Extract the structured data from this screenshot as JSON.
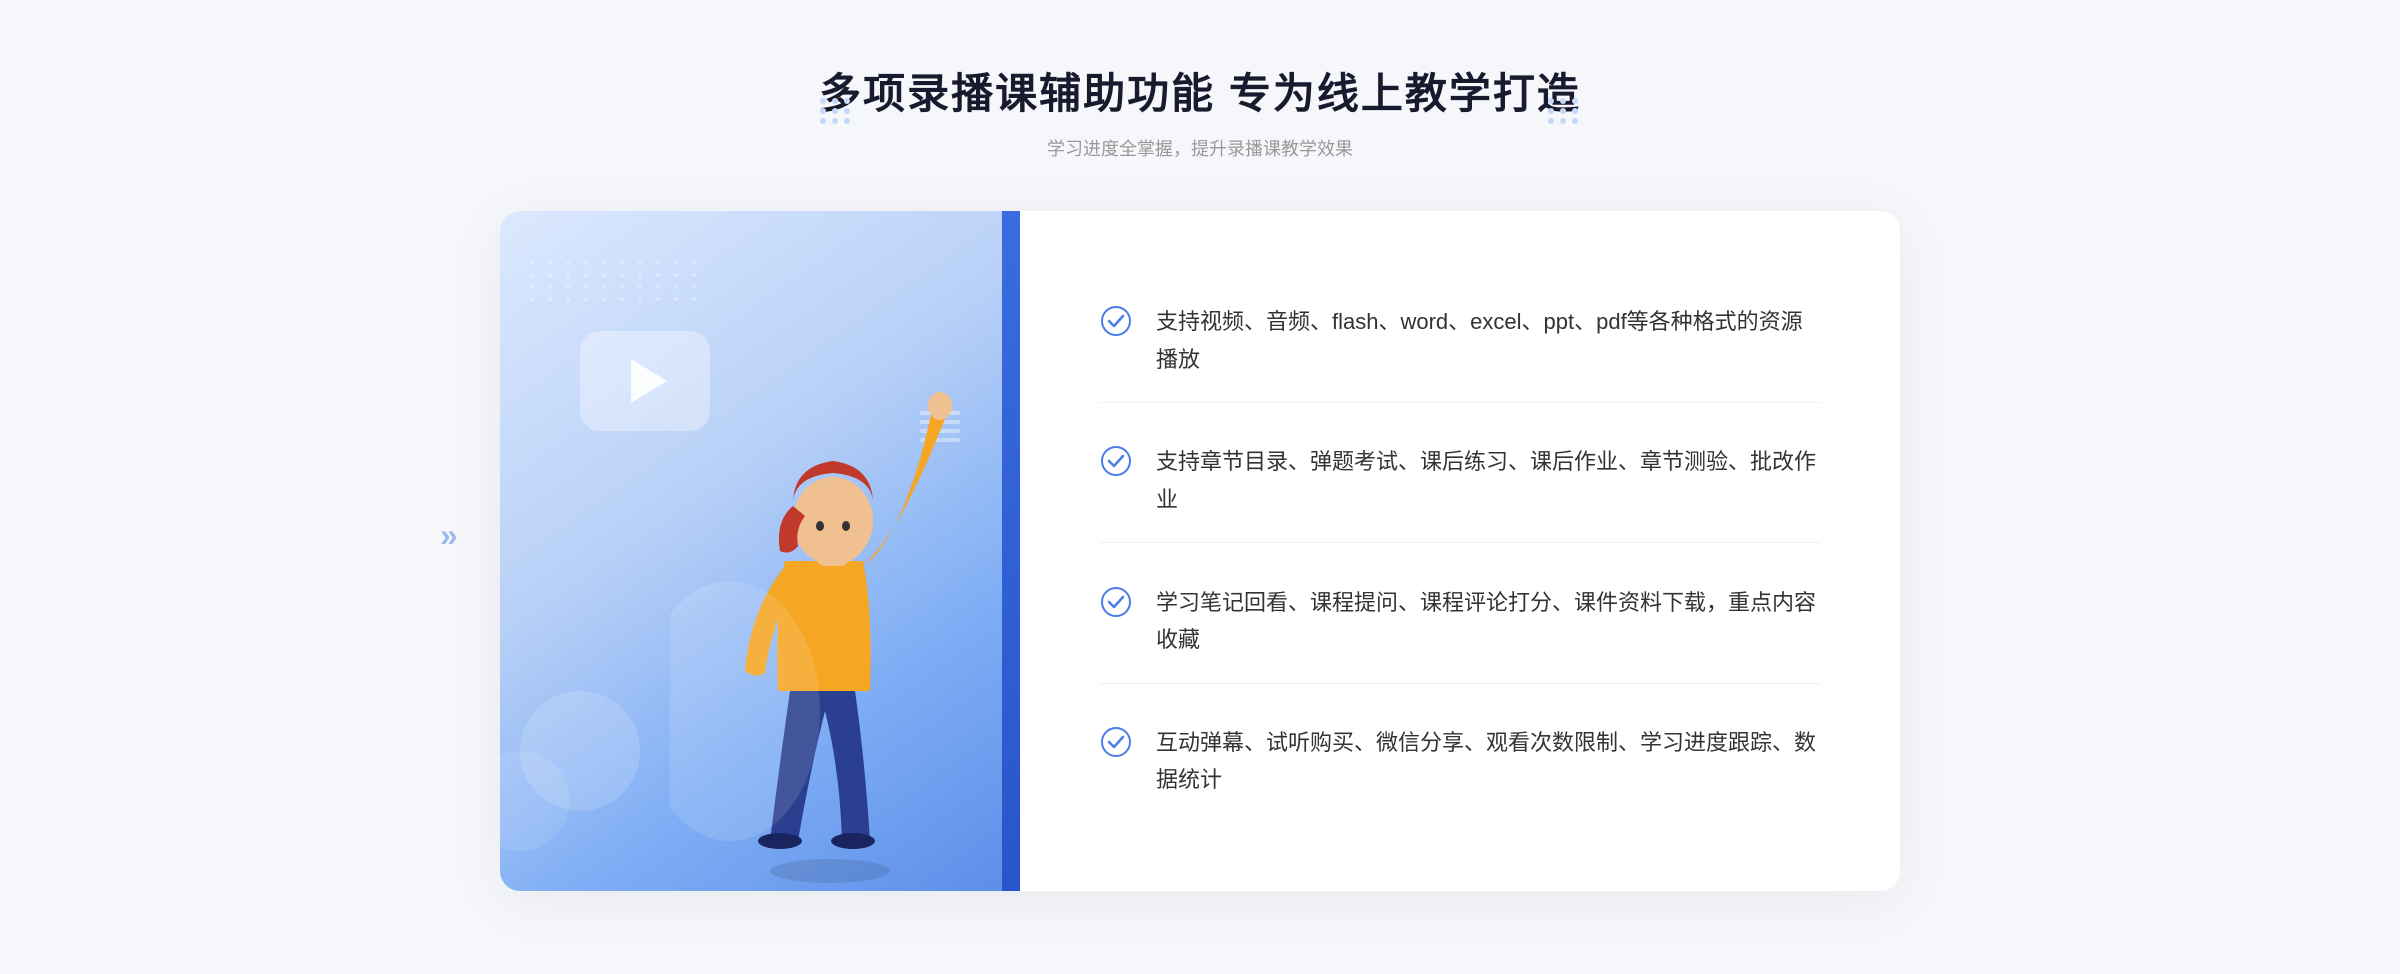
{
  "header": {
    "title": "多项录播课辅助功能 专为线上教学打造",
    "subtitle": "学习进度全掌握，提升录播课教学效果"
  },
  "features": [
    {
      "id": 1,
      "text": "支持视频、音频、flash、word、excel、ppt、pdf等各种格式的资源播放"
    },
    {
      "id": 2,
      "text": "支持章节目录、弹题考试、课后练习、课后作业、章节测验、批改作业"
    },
    {
      "id": 3,
      "text": "学习笔记回看、课程提问、课程评论打分、课件资料下载，重点内容收藏"
    },
    {
      "id": 4,
      "text": "互动弹幕、试听购买、微信分享、观看次数限制、学习进度跟踪、数据统计"
    }
  ],
  "icons": {
    "check": "check-circle-icon",
    "play": "play-icon"
  },
  "colors": {
    "accent": "#4a7de8",
    "title": "#1a1a2e",
    "subtitle": "#999999",
    "feature_text": "#333333"
  }
}
